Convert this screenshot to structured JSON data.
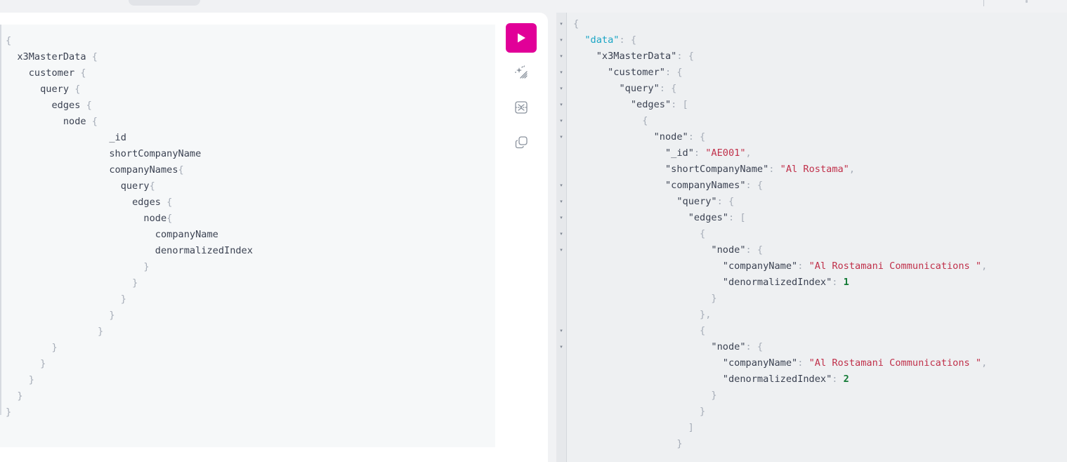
{
  "app": {
    "accent_color": "#e10098",
    "background": "#f1f2f4"
  },
  "toolbar": {
    "run_icon": "play-icon",
    "prettify_icon": "magic-wand-icon",
    "merge_fragments_icon": "merge-icon",
    "copy_icon": "copy-icon"
  },
  "query_editor": {
    "lines": [
      {
        "indent": "",
        "text": "",
        "punc": "{"
      },
      {
        "indent": "  ",
        "text": "x3MasterData ",
        "punc": "{"
      },
      {
        "indent": "    ",
        "text": "customer ",
        "punc": "{"
      },
      {
        "indent": "      ",
        "text": "query ",
        "punc": "{"
      },
      {
        "indent": "        ",
        "text": "edges ",
        "punc": "{"
      },
      {
        "indent": "          ",
        "text": "node ",
        "punc": "{"
      },
      {
        "indent": "                  ",
        "text": "_id",
        "punc": ""
      },
      {
        "indent": "                  ",
        "text": "shortCompanyName",
        "punc": ""
      },
      {
        "indent": "                  ",
        "text": "companyNames",
        "punc": "{"
      },
      {
        "indent": "                    ",
        "text": "query",
        "punc": "{"
      },
      {
        "indent": "                      ",
        "text": "edges ",
        "punc": "{"
      },
      {
        "indent": "                        ",
        "text": "node",
        "punc": "{"
      },
      {
        "indent": "                          ",
        "text": "companyName",
        "punc": ""
      },
      {
        "indent": "                          ",
        "text": "denormalizedIndex",
        "punc": ""
      },
      {
        "indent": "                        ",
        "text": "",
        "punc": "}"
      },
      {
        "indent": "                      ",
        "text": "",
        "punc": "}"
      },
      {
        "indent": "                    ",
        "text": "",
        "punc": "}"
      },
      {
        "indent": "                  ",
        "text": "",
        "punc": "}"
      },
      {
        "indent": "                ",
        "text": "",
        "punc": "}"
      },
      {
        "indent": "        ",
        "text": "",
        "punc": "}"
      },
      {
        "indent": "      ",
        "text": "",
        "punc": "}"
      },
      {
        "indent": "    ",
        "text": "",
        "punc": "}"
      },
      {
        "indent": "  ",
        "text": "",
        "punc": "}"
      },
      {
        "indent": "",
        "text": "",
        "punc": "}"
      }
    ]
  },
  "result_viewer": {
    "fold_arrow_glyph": "▾",
    "fold_rows": [
      0,
      1,
      2,
      3,
      4,
      5,
      6,
      7,
      10,
      11,
      12,
      13,
      14,
      19,
      20
    ],
    "lines": [
      [
        {
          "c": "punc",
          "t": "{"
        }
      ],
      [
        {
          "c": "punc",
          "t": "  "
        },
        {
          "c": "key-top",
          "t": "\"data\""
        },
        {
          "c": "punc",
          "t": ": {"
        }
      ],
      [
        {
          "c": "punc",
          "t": "    "
        },
        {
          "c": "key",
          "t": "\"x3MasterData\""
        },
        {
          "c": "punc",
          "t": ": {"
        }
      ],
      [
        {
          "c": "punc",
          "t": "      "
        },
        {
          "c": "key",
          "t": "\"customer\""
        },
        {
          "c": "punc",
          "t": ": {"
        }
      ],
      [
        {
          "c": "punc",
          "t": "        "
        },
        {
          "c": "key",
          "t": "\"query\""
        },
        {
          "c": "punc",
          "t": ": {"
        }
      ],
      [
        {
          "c": "punc",
          "t": "          "
        },
        {
          "c": "key",
          "t": "\"edges\""
        },
        {
          "c": "punc",
          "t": ": ["
        }
      ],
      [
        {
          "c": "punc",
          "t": "            {"
        }
      ],
      [
        {
          "c": "punc",
          "t": "              "
        },
        {
          "c": "key",
          "t": "\"node\""
        },
        {
          "c": "punc",
          "t": ": {"
        }
      ],
      [
        {
          "c": "punc",
          "t": "                "
        },
        {
          "c": "key",
          "t": "\"_id\""
        },
        {
          "c": "punc",
          "t": ": "
        },
        {
          "c": "str",
          "t": "\"AE001\""
        },
        {
          "c": "punc",
          "t": ","
        }
      ],
      [
        {
          "c": "punc",
          "t": "                "
        },
        {
          "c": "key",
          "t": "\"shortCompanyName\""
        },
        {
          "c": "punc",
          "t": ": "
        },
        {
          "c": "str",
          "t": "\"Al Rostama\""
        },
        {
          "c": "punc",
          "t": ","
        }
      ],
      [
        {
          "c": "punc",
          "t": "                "
        },
        {
          "c": "key",
          "t": "\"companyNames\""
        },
        {
          "c": "punc",
          "t": ": {"
        }
      ],
      [
        {
          "c": "punc",
          "t": "                  "
        },
        {
          "c": "key",
          "t": "\"query\""
        },
        {
          "c": "punc",
          "t": ": {"
        }
      ],
      [
        {
          "c": "punc",
          "t": "                    "
        },
        {
          "c": "key",
          "t": "\"edges\""
        },
        {
          "c": "punc",
          "t": ": ["
        }
      ],
      [
        {
          "c": "punc",
          "t": "                      {"
        }
      ],
      [
        {
          "c": "punc",
          "t": "                        "
        },
        {
          "c": "key",
          "t": "\"node\""
        },
        {
          "c": "punc",
          "t": ": {"
        }
      ],
      [
        {
          "c": "punc",
          "t": "                          "
        },
        {
          "c": "key",
          "t": "\"companyName\""
        },
        {
          "c": "punc",
          "t": ": "
        },
        {
          "c": "str",
          "t": "\"Al Rostamani Communications \""
        },
        {
          "c": "punc",
          "t": ","
        }
      ],
      [
        {
          "c": "punc",
          "t": "                          "
        },
        {
          "c": "key",
          "t": "\"denormalizedIndex\""
        },
        {
          "c": "punc",
          "t": ": "
        },
        {
          "c": "num",
          "t": "1"
        }
      ],
      [
        {
          "c": "punc",
          "t": "                        }"
        }
      ],
      [
        {
          "c": "punc",
          "t": "                      },"
        }
      ],
      [
        {
          "c": "punc",
          "t": "                      {"
        }
      ],
      [
        {
          "c": "punc",
          "t": "                        "
        },
        {
          "c": "key",
          "t": "\"node\""
        },
        {
          "c": "punc",
          "t": ": {"
        }
      ],
      [
        {
          "c": "punc",
          "t": "                          "
        },
        {
          "c": "key",
          "t": "\"companyName\""
        },
        {
          "c": "punc",
          "t": ": "
        },
        {
          "c": "str",
          "t": "\"Al Rostamani Communications \""
        },
        {
          "c": "punc",
          "t": ","
        }
      ],
      [
        {
          "c": "punc",
          "t": "                          "
        },
        {
          "c": "key",
          "t": "\"denormalizedIndex\""
        },
        {
          "c": "punc",
          "t": ": "
        },
        {
          "c": "num",
          "t": "2"
        }
      ],
      [
        {
          "c": "punc",
          "t": "                        }"
        }
      ],
      [
        {
          "c": "punc",
          "t": "                      }"
        }
      ],
      [
        {
          "c": "punc",
          "t": "                    ]"
        }
      ],
      [
        {
          "c": "punc",
          "t": "                  }"
        }
      ]
    ]
  }
}
